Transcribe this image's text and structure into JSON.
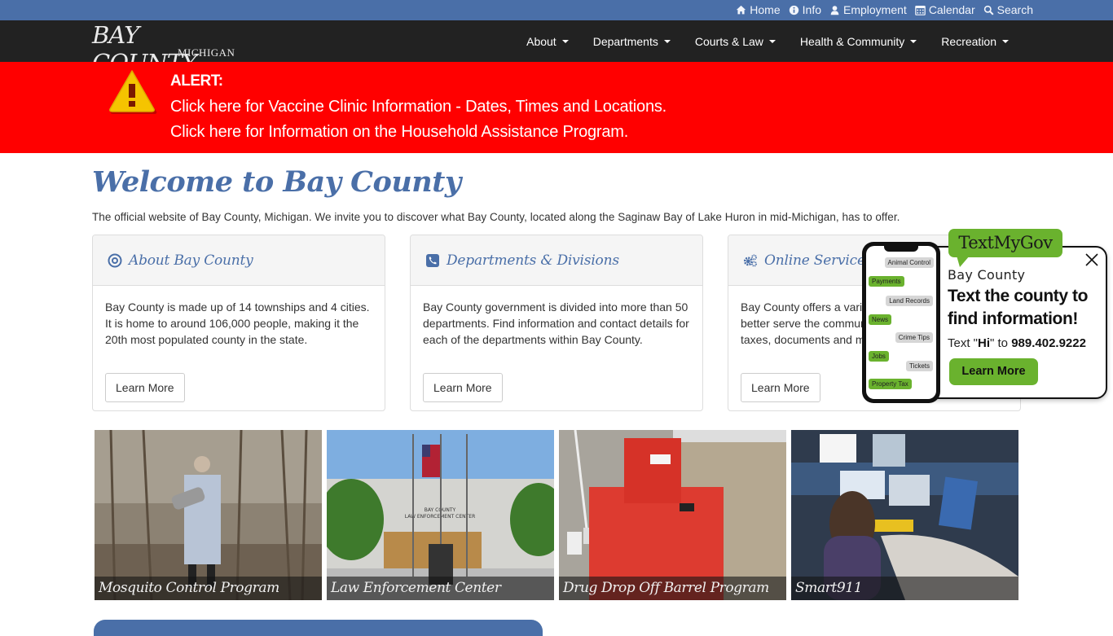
{
  "utility": {
    "links": [
      {
        "label": "Home",
        "icon": "home-icon"
      },
      {
        "label": "Info",
        "icon": "info-icon"
      },
      {
        "label": "Employment",
        "icon": "user-icon"
      },
      {
        "label": "Calendar",
        "icon": "calendar-icon"
      },
      {
        "label": "Search",
        "icon": "search-icon"
      }
    ]
  },
  "logo": {
    "main": "BAY COUNTY",
    "sub": "MICHIGAN"
  },
  "nav": {
    "items": [
      {
        "label": "About"
      },
      {
        "label": "Departments"
      },
      {
        "label": "Courts & Law"
      },
      {
        "label": "Health & Community"
      },
      {
        "label": "Recreation"
      }
    ]
  },
  "alert": {
    "title": "ALERT:",
    "links": [
      "Click here for Vaccine Clinic Information - Dates, Times and Locations.",
      "Click here for Information on the Household Assistance Program."
    ],
    "colors": {
      "background": "#ff0000",
      "icon": "#f5c400"
    }
  },
  "welcome": {
    "title": "Welcome to Bay County",
    "intro": "The official website of Bay County, Michigan. We invite you to discover what Bay County, located along the Saginaw Bay of Lake Huron in mid-Michigan, has to offer."
  },
  "cards": [
    {
      "title": "About Bay County",
      "icon": "compass-icon",
      "text": "Bay County is made up of 14 townships and 4 cities. It is home to around 106,000 people, making it the 20th most populated county in the state.",
      "button": "Learn More"
    },
    {
      "title": "Departments & Divisions",
      "icon": "phone-icon",
      "text": "Bay County government is divided into more than 50 departments. Find information and contact details for each of the departments within Bay County.",
      "button": "Learn More"
    },
    {
      "title": "Online Services",
      "icon": "gears-icon",
      "text": "Bay County offers a variety of online services to better serve the community, including employment, taxes, documents and more.",
      "button": "Learn More"
    }
  ],
  "tiles": [
    {
      "caption": "Mosquito Control Program"
    },
    {
      "caption": "Law Enforcement Center"
    },
    {
      "caption": "Drug Drop Off Barrel Program"
    },
    {
      "caption": "Smart911"
    }
  ],
  "textmygov": {
    "brand": "TextMyGov",
    "county": "Bay County",
    "headline": "Text the county to find information!",
    "text_prefix": "Text \"",
    "keyword": "Hi",
    "text_mid": "\" to ",
    "number": "989.402.9222",
    "button": "Learn More",
    "bubbles": [
      "Animal Control",
      "Payments",
      "Land Records",
      "News",
      "Crime Tips",
      "Jobs",
      "Tickets",
      "Property Tax"
    ],
    "colors": {
      "green": "#6ab22e",
      "gray": "#d6d6d6"
    }
  },
  "theme": {
    "accent": "#4a6fa8",
    "nav_bg": "#222222"
  }
}
